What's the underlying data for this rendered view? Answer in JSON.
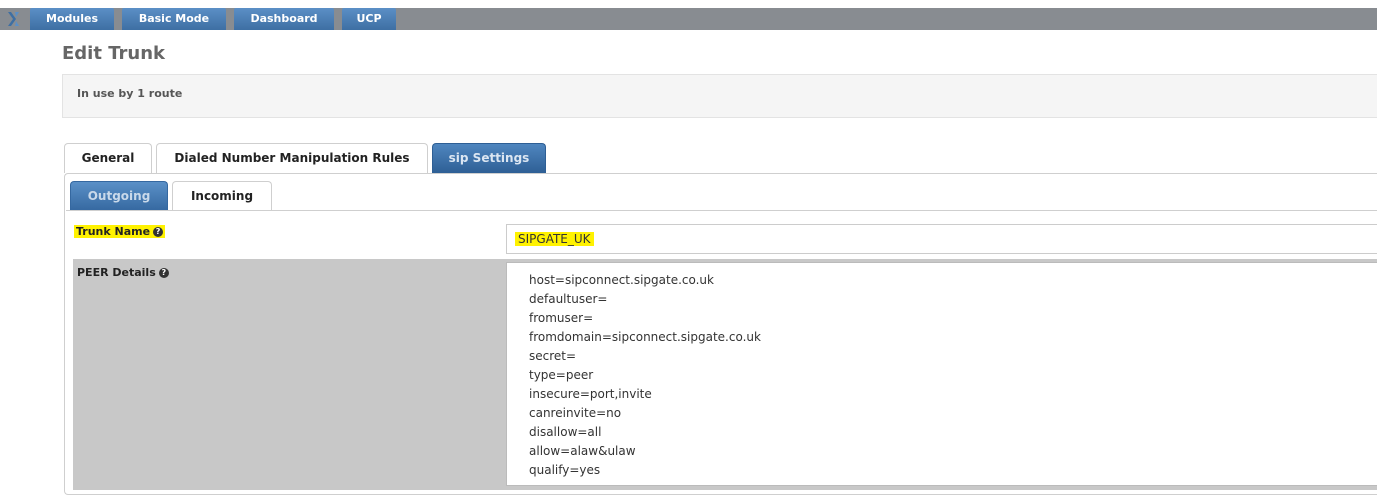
{
  "nav": {
    "items": [
      {
        "label": "Modules"
      },
      {
        "label": "Basic Mode"
      },
      {
        "label": "Dashboard"
      },
      {
        "label": "UCP"
      }
    ]
  },
  "page": {
    "title": "Edit Trunk",
    "usage_text": "In use by 1 route"
  },
  "tabs": [
    {
      "label": "General"
    },
    {
      "label": "Dialed Number Manipulation Rules"
    },
    {
      "label": "sip Settings"
    }
  ],
  "subtabs": [
    {
      "label": "Outgoing"
    },
    {
      "label": "Incoming"
    }
  ],
  "trunk_name": {
    "label": "Trunk Name",
    "value": "SIPGATE_UK"
  },
  "peer_details": {
    "label": "PEER Details",
    "lines": [
      "host=sipconnect.sipgate.co.uk",
      "defaultuser=",
      "fromuser=",
      "fromdomain=sipconnect.sipgate.co.uk",
      "secret=",
      "type=peer",
      "insecure=port,invite",
      "canreinvite=no",
      "disallow=all",
      "allow=alaw&ulaw",
      "qualify=yes"
    ]
  },
  "colors": {
    "nav_bar": "#888c91",
    "nav_button": "#4a7db3",
    "active_tab": "#2e5f95",
    "highlight": "#fff200"
  }
}
